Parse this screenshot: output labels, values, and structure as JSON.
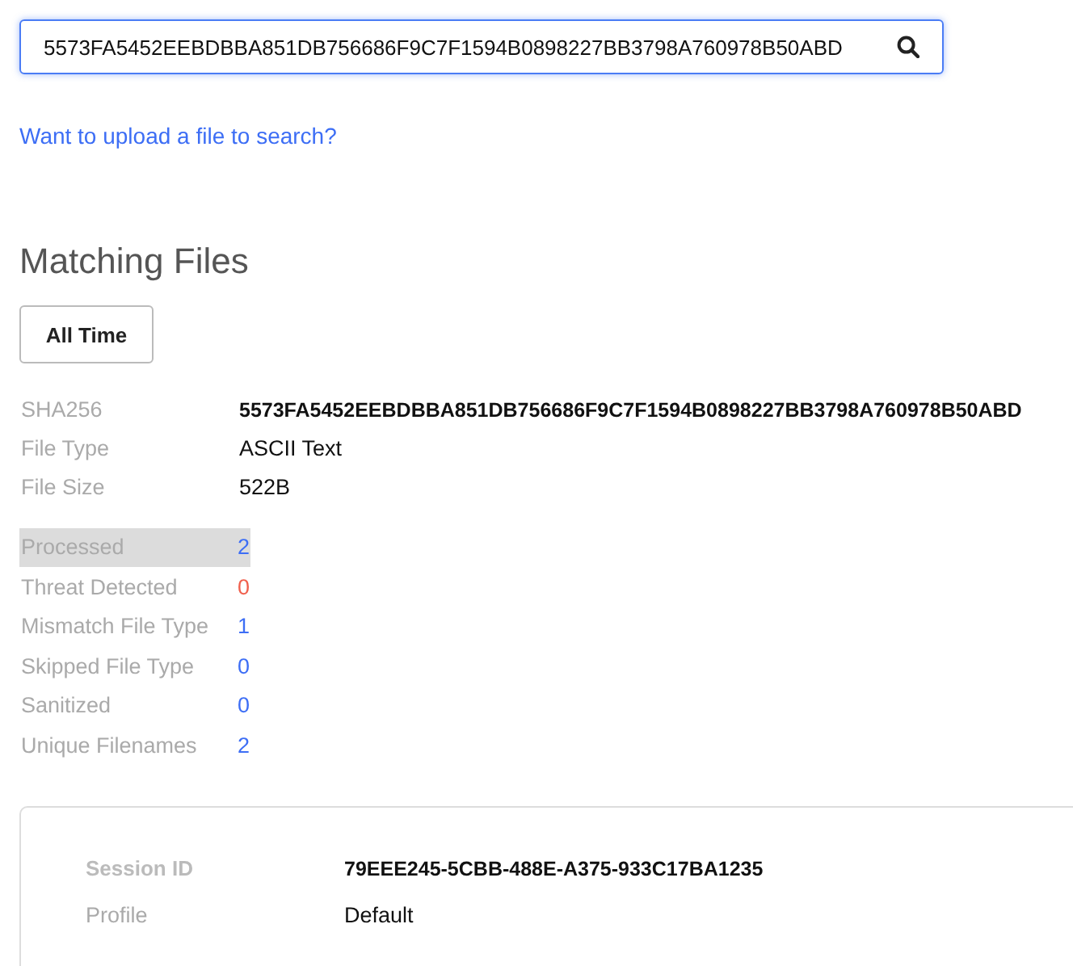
{
  "search": {
    "value": "5573FA5452EEBDBBA851DB756686F9C7F1594B0898227BB3798A760978B50ABD"
  },
  "upload_link": "Want to upload a file to search?",
  "heading": "Matching Files",
  "time_filter": "All Time",
  "file_details": [
    {
      "label": "SHA256",
      "value": "5573FA5452EEBDBBA851DB756686F9C7F1594B0898227BB3798A760978B50ABD",
      "bold": true
    },
    {
      "label": "File Type",
      "value": "ASCII Text",
      "bold": false
    },
    {
      "label": "File Size",
      "value": "522B",
      "bold": false
    }
  ],
  "stats": [
    {
      "label": "Processed",
      "value": "2",
      "color": "#3d6ef5",
      "highlighted": true
    },
    {
      "label": "Threat Detected",
      "value": "0",
      "color": "#f0604d",
      "highlighted": false
    },
    {
      "label": "Mismatch File Type",
      "value": "1",
      "color": "#3d6ef5",
      "highlighted": false
    },
    {
      "label": "Skipped File Type",
      "value": "0",
      "color": "#3d6ef5",
      "highlighted": false
    },
    {
      "label": "Sanitized",
      "value": "0",
      "color": "#3d6ef5",
      "highlighted": false
    },
    {
      "label": "Unique Filenames",
      "value": "2",
      "color": "#3d6ef5",
      "highlighted": false
    }
  ],
  "session": [
    {
      "label": "Session ID",
      "value": "79EEE245-5CBB-488E-A375-933C17BA1235",
      "bold": true
    },
    {
      "label": "Profile",
      "value": "Default",
      "bold": false
    }
  ]
}
